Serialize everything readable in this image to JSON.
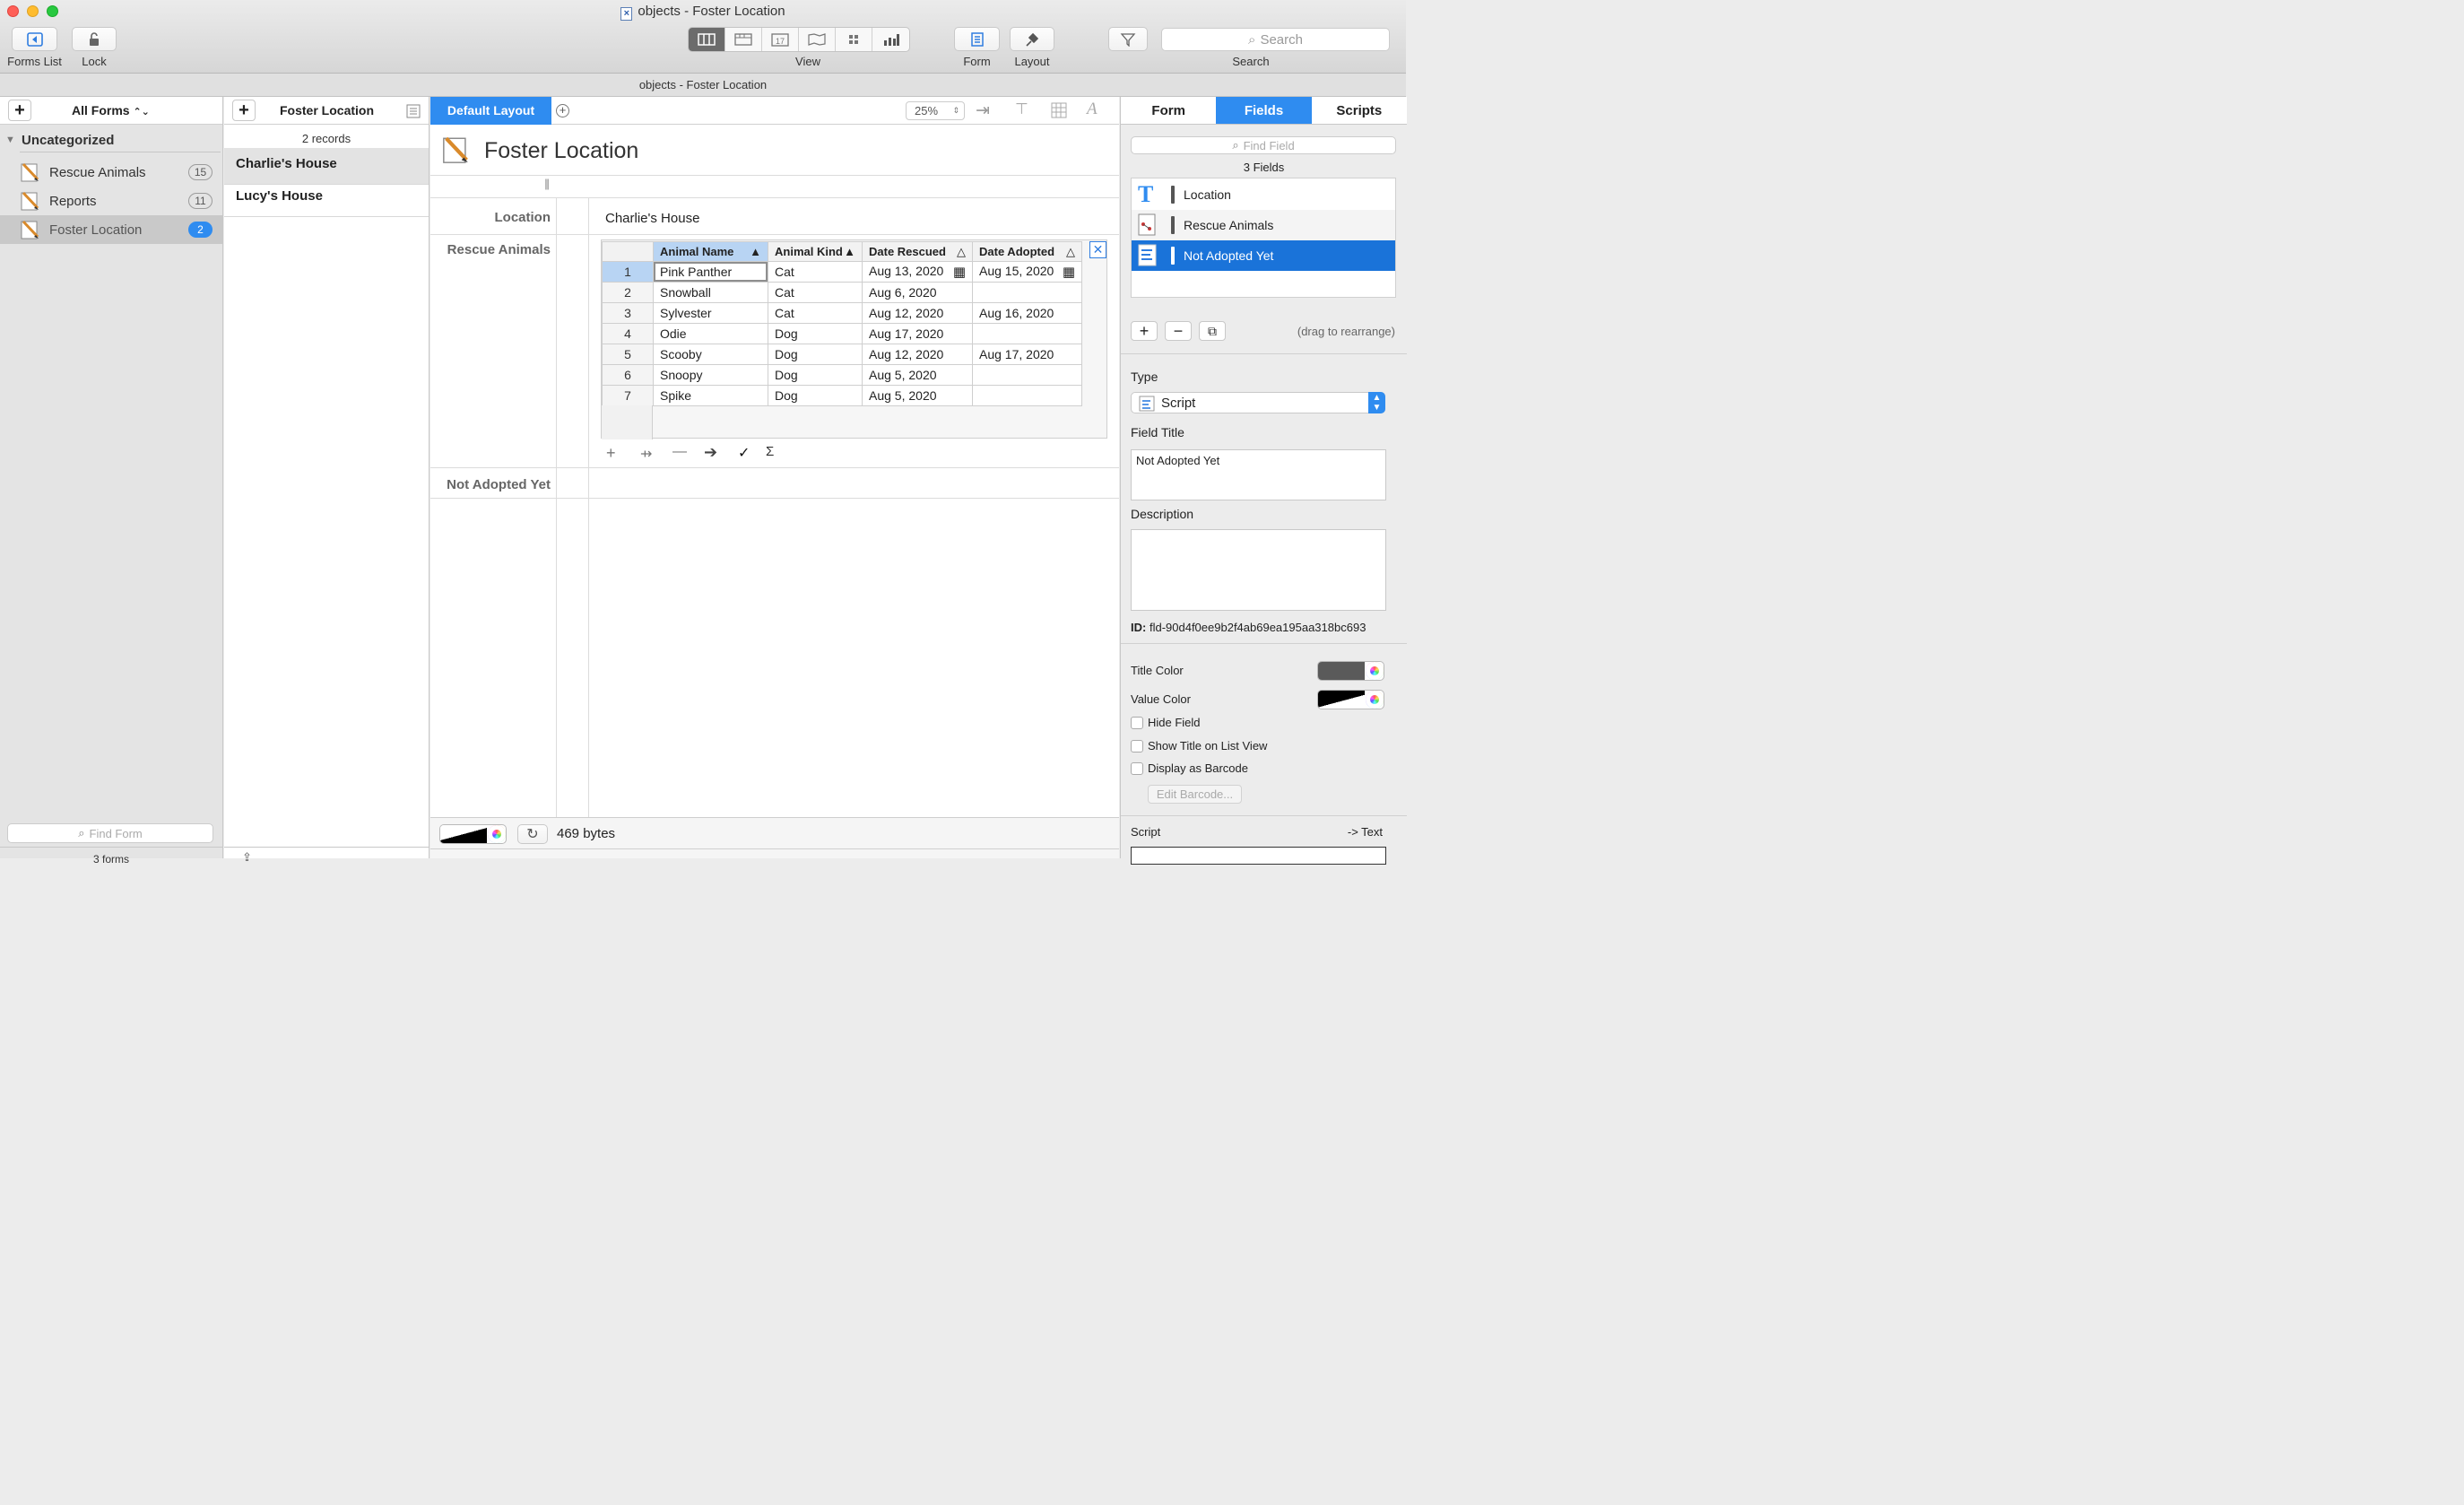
{
  "window": {
    "title": "objects - Foster Location",
    "subtitle": "objects - Foster Location"
  },
  "toolbar": {
    "forms_list_label": "Forms List",
    "lock_label": "Lock",
    "view_label": "View",
    "form_label": "Form",
    "layout_label": "Layout",
    "search_placeholder": "Search",
    "search_label": "Search"
  },
  "sidebar": {
    "header": "All Forms",
    "group": "Uncategorized",
    "items": [
      {
        "label": "Rescue Animals",
        "count": "15"
      },
      {
        "label": "Reports",
        "count": "11"
      },
      {
        "label": "Foster Location",
        "count": "2"
      }
    ],
    "find_placeholder": "Find Form",
    "footer": "3 forms"
  },
  "records": {
    "title": "Foster Location",
    "count_text": "2 records",
    "items": [
      "Charlie's House",
      "Lucy's House"
    ]
  },
  "layout": {
    "tab": "Default Layout",
    "zoom": "25%",
    "form_title": "Foster Location",
    "location_label": "Location",
    "location_value": "Charlie's House",
    "rescue_label": "Rescue Animals",
    "not_adopted_label": "Not Adopted Yet",
    "table": {
      "headers": [
        "Animal Name",
        "Animal Kind",
        "Date Rescued",
        "Date Adopted"
      ],
      "rows": [
        [
          "1",
          "Pink Panther",
          "Cat",
          "Aug 13, 2020",
          "Aug 15, 2020"
        ],
        [
          "2",
          "Snowball",
          "Cat",
          "Aug 6, 2020",
          ""
        ],
        [
          "3",
          "Sylvester",
          "Cat",
          "Aug 12, 2020",
          "Aug 16, 2020"
        ],
        [
          "4",
          "Odie",
          "Dog",
          "Aug 17, 2020",
          ""
        ],
        [
          "5",
          "Scooby",
          "Dog",
          "Aug 12, 2020",
          "Aug 17, 2020"
        ],
        [
          "6",
          "Snoopy",
          "Dog",
          "Aug 5, 2020",
          ""
        ],
        [
          "7",
          "Spike",
          "Dog",
          "Aug 5, 2020",
          ""
        ]
      ]
    },
    "bytes": "469 bytes"
  },
  "panel": {
    "tabs": [
      "Form",
      "Fields",
      "Scripts"
    ],
    "find_field_placeholder": "Find Field",
    "field_count": "3 Fields",
    "fields": [
      "Location",
      "Rescue Animals",
      "Not Adopted Yet"
    ],
    "drag_hint": "(drag to rearrange)",
    "type_label": "Type",
    "type_value": "Script",
    "field_title_label": "Field Title",
    "field_title_value": "Not Adopted Yet",
    "description_label": "Description",
    "id_label": "ID:",
    "id_value": "fld-90d4f0ee9b2f4ab69ea195aa318bc693",
    "title_color_label": "Title Color",
    "value_color_label": "Value Color",
    "hide_field": "Hide Field",
    "show_title": "Show Title on List View",
    "display_barcode": "Display as Barcode",
    "edit_barcode": "Edit Barcode...",
    "script_label": "Script",
    "script_type": "-> Text"
  },
  "colors": {
    "accent": "#2f8cf0",
    "selection": "#1a73d9",
    "title_color": "#5a5a5a"
  }
}
